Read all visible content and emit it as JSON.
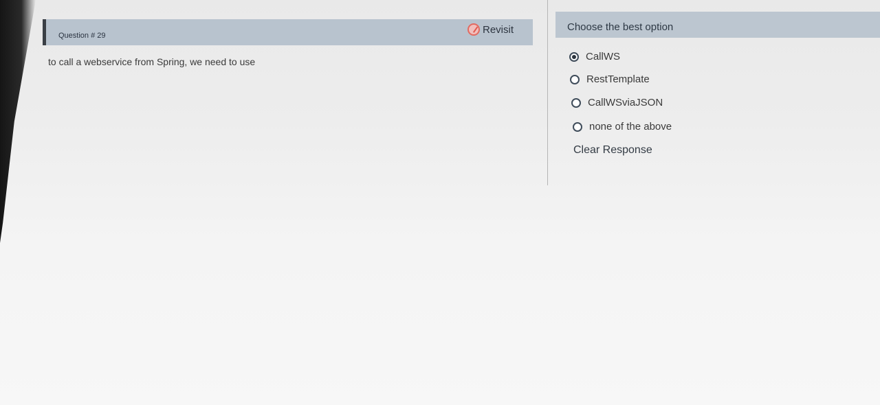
{
  "question": {
    "title": "Question # 29",
    "text": "to call a webservice from Spring, we need to use",
    "revisit_label": "Revisit"
  },
  "answers": {
    "header": "Choose the best option",
    "options": [
      {
        "label": "CallWS",
        "selected": true
      },
      {
        "label": "RestTemplate",
        "selected": false
      },
      {
        "label": "CallWSviaJSON",
        "selected": false
      },
      {
        "label": "none of the above",
        "selected": false
      }
    ],
    "clear_label": "Clear Response"
  },
  "colors": {
    "header_bg": "#b8c3ce",
    "revisit_accent": "#e36a60"
  }
}
